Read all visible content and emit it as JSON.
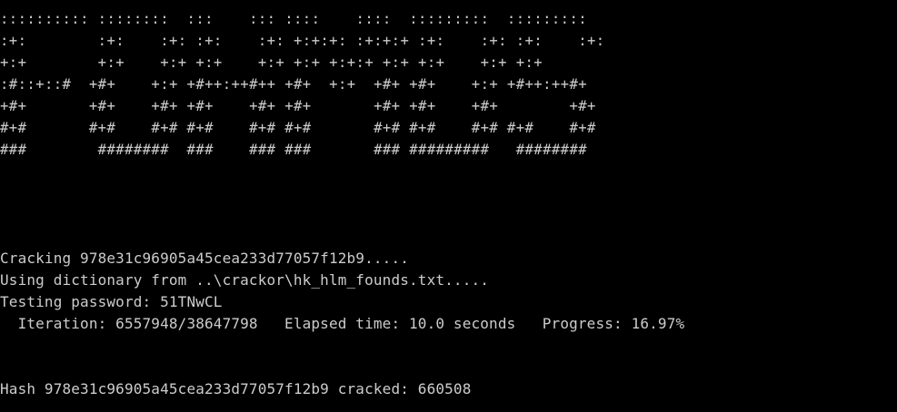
{
  "terminal": {
    "background": "#000000",
    "text_color": "#cccccc",
    "banner": [
      ":::::::::: ::::::::  :::    ::: ::::    ::::  :::::::::  :::::::::",
      ":+:        :+:    :+: :+:    :+: +:+:+: :+:+:+ :+:    :+: :+:    :+:",
      "+:+        +:+    +:+ +:+    +:+ +:+ +:+:+ +:+ +:+    +:+ +:+",
      ":#::+::#  +#+    +:+ +#++:++#++ +#+  +:+  +#+ +#+    +:+ +#++:++#+",
      "+#+       +#+    +#+ +#+    +#+ +#+       +#+ +#+    +#+        +#+",
      "#+#       #+#    #+# #+#    #+# #+#       #+# #+#    #+# #+#    #+#",
      "###        ########  ###    ### ###       ### #########   ########"
    ],
    "cracking_line": "Cracking 978e31c96905a45cea233d77057f12b9.....",
    "dictionary_line": "Using dictionary from ..\\crackor\\hk_hlm_founds.txt.....",
    "testing_line": "Testing password: 51TNwCL",
    "iteration_line": "  Iteration: 6557948/38647798   Elapsed time: 10.0 seconds   Progress: 16.97%",
    "result_line": "Hash 978e31c96905a45cea233d77057f12b9 cracked: 660508"
  }
}
